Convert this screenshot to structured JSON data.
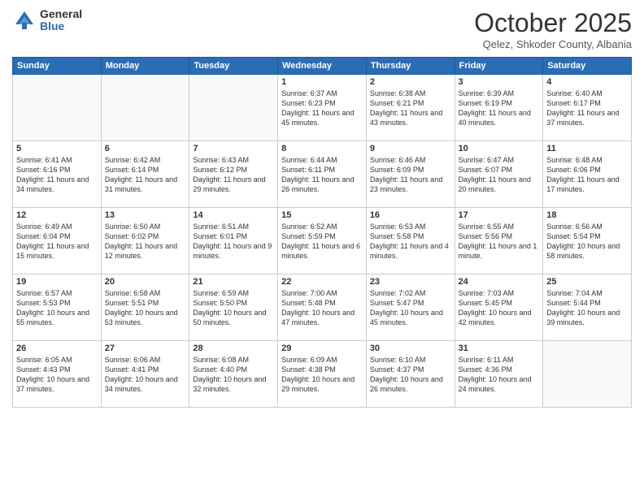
{
  "header": {
    "logo_general": "General",
    "logo_blue": "Blue",
    "month_title": "October 2025",
    "subtitle": "Qelez, Shkoder County, Albania"
  },
  "days_of_week": [
    "Sunday",
    "Monday",
    "Tuesday",
    "Wednesday",
    "Thursday",
    "Friday",
    "Saturday"
  ],
  "weeks": [
    [
      {
        "day": "",
        "info": ""
      },
      {
        "day": "",
        "info": ""
      },
      {
        "day": "",
        "info": ""
      },
      {
        "day": "1",
        "info": "Sunrise: 6:37 AM\nSunset: 6:23 PM\nDaylight: 11 hours\nand 45 minutes."
      },
      {
        "day": "2",
        "info": "Sunrise: 6:38 AM\nSunset: 6:21 PM\nDaylight: 11 hours\nand 43 minutes."
      },
      {
        "day": "3",
        "info": "Sunrise: 6:39 AM\nSunset: 6:19 PM\nDaylight: 11 hours\nand 40 minutes."
      },
      {
        "day": "4",
        "info": "Sunrise: 6:40 AM\nSunset: 6:17 PM\nDaylight: 11 hours\nand 37 minutes."
      }
    ],
    [
      {
        "day": "5",
        "info": "Sunrise: 6:41 AM\nSunset: 6:16 PM\nDaylight: 11 hours\nand 34 minutes."
      },
      {
        "day": "6",
        "info": "Sunrise: 6:42 AM\nSunset: 6:14 PM\nDaylight: 11 hours\nand 31 minutes."
      },
      {
        "day": "7",
        "info": "Sunrise: 6:43 AM\nSunset: 6:12 PM\nDaylight: 11 hours\nand 29 minutes."
      },
      {
        "day": "8",
        "info": "Sunrise: 6:44 AM\nSunset: 6:11 PM\nDaylight: 11 hours\nand 26 minutes."
      },
      {
        "day": "9",
        "info": "Sunrise: 6:46 AM\nSunset: 6:09 PM\nDaylight: 11 hours\nand 23 minutes."
      },
      {
        "day": "10",
        "info": "Sunrise: 6:47 AM\nSunset: 6:07 PM\nDaylight: 11 hours\nand 20 minutes."
      },
      {
        "day": "11",
        "info": "Sunrise: 6:48 AM\nSunset: 6:06 PM\nDaylight: 11 hours\nand 17 minutes."
      }
    ],
    [
      {
        "day": "12",
        "info": "Sunrise: 6:49 AM\nSunset: 6:04 PM\nDaylight: 11 hours\nand 15 minutes."
      },
      {
        "day": "13",
        "info": "Sunrise: 6:50 AM\nSunset: 6:02 PM\nDaylight: 11 hours\nand 12 minutes."
      },
      {
        "day": "14",
        "info": "Sunrise: 6:51 AM\nSunset: 6:01 PM\nDaylight: 11 hours\nand 9 minutes."
      },
      {
        "day": "15",
        "info": "Sunrise: 6:52 AM\nSunset: 5:59 PM\nDaylight: 11 hours\nand 6 minutes."
      },
      {
        "day": "16",
        "info": "Sunrise: 6:53 AM\nSunset: 5:58 PM\nDaylight: 11 hours\nand 4 minutes."
      },
      {
        "day": "17",
        "info": "Sunrise: 6:55 AM\nSunset: 5:56 PM\nDaylight: 11 hours\nand 1 minute."
      },
      {
        "day": "18",
        "info": "Sunrise: 6:56 AM\nSunset: 5:54 PM\nDaylight: 10 hours\nand 58 minutes."
      }
    ],
    [
      {
        "day": "19",
        "info": "Sunrise: 6:57 AM\nSunset: 5:53 PM\nDaylight: 10 hours\nand 55 minutes."
      },
      {
        "day": "20",
        "info": "Sunrise: 6:58 AM\nSunset: 5:51 PM\nDaylight: 10 hours\nand 53 minutes."
      },
      {
        "day": "21",
        "info": "Sunrise: 6:59 AM\nSunset: 5:50 PM\nDaylight: 10 hours\nand 50 minutes."
      },
      {
        "day": "22",
        "info": "Sunrise: 7:00 AM\nSunset: 5:48 PM\nDaylight: 10 hours\nand 47 minutes."
      },
      {
        "day": "23",
        "info": "Sunrise: 7:02 AM\nSunset: 5:47 PM\nDaylight: 10 hours\nand 45 minutes."
      },
      {
        "day": "24",
        "info": "Sunrise: 7:03 AM\nSunset: 5:45 PM\nDaylight: 10 hours\nand 42 minutes."
      },
      {
        "day": "25",
        "info": "Sunrise: 7:04 AM\nSunset: 5:44 PM\nDaylight: 10 hours\nand 39 minutes."
      }
    ],
    [
      {
        "day": "26",
        "info": "Sunrise: 6:05 AM\nSunset: 4:43 PM\nDaylight: 10 hours\nand 37 minutes."
      },
      {
        "day": "27",
        "info": "Sunrise: 6:06 AM\nSunset: 4:41 PM\nDaylight: 10 hours\nand 34 minutes."
      },
      {
        "day": "28",
        "info": "Sunrise: 6:08 AM\nSunset: 4:40 PM\nDaylight: 10 hours\nand 32 minutes."
      },
      {
        "day": "29",
        "info": "Sunrise: 6:09 AM\nSunset: 4:38 PM\nDaylight: 10 hours\nand 29 minutes."
      },
      {
        "day": "30",
        "info": "Sunrise: 6:10 AM\nSunset: 4:37 PM\nDaylight: 10 hours\nand 26 minutes."
      },
      {
        "day": "31",
        "info": "Sunrise: 6:11 AM\nSunset: 4:36 PM\nDaylight: 10 hours\nand 24 minutes."
      },
      {
        "day": "",
        "info": ""
      }
    ]
  ]
}
